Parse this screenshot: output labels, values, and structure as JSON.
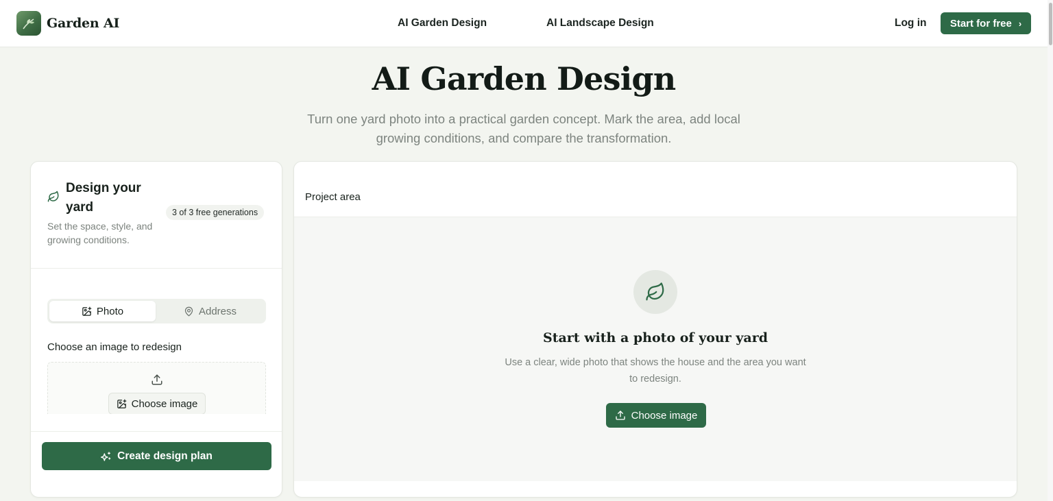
{
  "header": {
    "brand_name": "Garden AI",
    "nav": [
      {
        "label": "AI Garden Design"
      },
      {
        "label": "AI Landscape Design"
      }
    ],
    "login_label": "Log in",
    "start_label": "Start for free",
    "start_chevron": "›"
  },
  "hero": {
    "title": "AI Garden Design",
    "subtitle": "Turn one yard photo into a practical garden concept. Mark the area, add local growing conditions, and compare the transformation."
  },
  "form_panel": {
    "title": "Design your yard",
    "description": "Set the space, style, and growing conditions.",
    "generations_badge": "3 of 3 free generations",
    "tabs": [
      {
        "label": "Photo",
        "icon": "image-icon",
        "selected": true
      },
      {
        "label": "Address",
        "icon": "map-pin-icon",
        "selected": false
      }
    ],
    "image_label": "Choose an image to redesign",
    "upload_button_label": "Choose image",
    "create_button_label": "Create design plan"
  },
  "preview_panel": {
    "section_label": "Project area",
    "empty_title": "Start with a photo of your yard",
    "empty_description": "Use a clear, wide photo that shows the house and the area you want to redesign.",
    "choose_button_label": "Choose image"
  },
  "colors": {
    "brand_green": "#2e6a47",
    "page_background": "#f3f5f0",
    "card_background": "#ffffff",
    "muted_text": "#7d847f"
  }
}
